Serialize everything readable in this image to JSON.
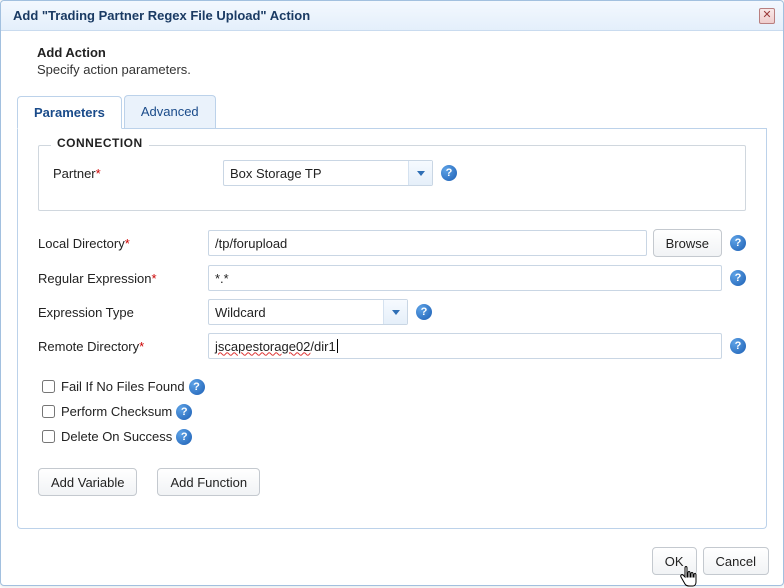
{
  "dialog": {
    "title": "Add \"Trading Partner Regex File Upload\" Action"
  },
  "heading": {
    "title": "Add Action",
    "subtitle": "Specify action parameters."
  },
  "tabs": {
    "parameters": "Parameters",
    "advanced": "Advanced"
  },
  "connection": {
    "legend": "CONNECTION",
    "partner_label": "Partner",
    "partner_value": "Box Storage TP"
  },
  "fields": {
    "local_dir_label": "Local Directory",
    "local_dir_value": "/tp/forupload",
    "browse_label": "Browse",
    "regex_label": "Regular Expression",
    "regex_value": "*.*",
    "expr_type_label": "Expression Type",
    "expr_type_value": "Wildcard",
    "remote_dir_label": "Remote Directory",
    "remote_dir_value_a": "jscapestorage02",
    "remote_dir_value_b": "/dir1"
  },
  "checks": {
    "fail_if_none": "Fail If No Files Found",
    "checksum": "Perform Checksum",
    "delete_on_success": "Delete On Success"
  },
  "actions": {
    "add_variable": "Add Variable",
    "add_function": "Add Function"
  },
  "footer": {
    "ok": "OK",
    "cancel": "Cancel"
  }
}
